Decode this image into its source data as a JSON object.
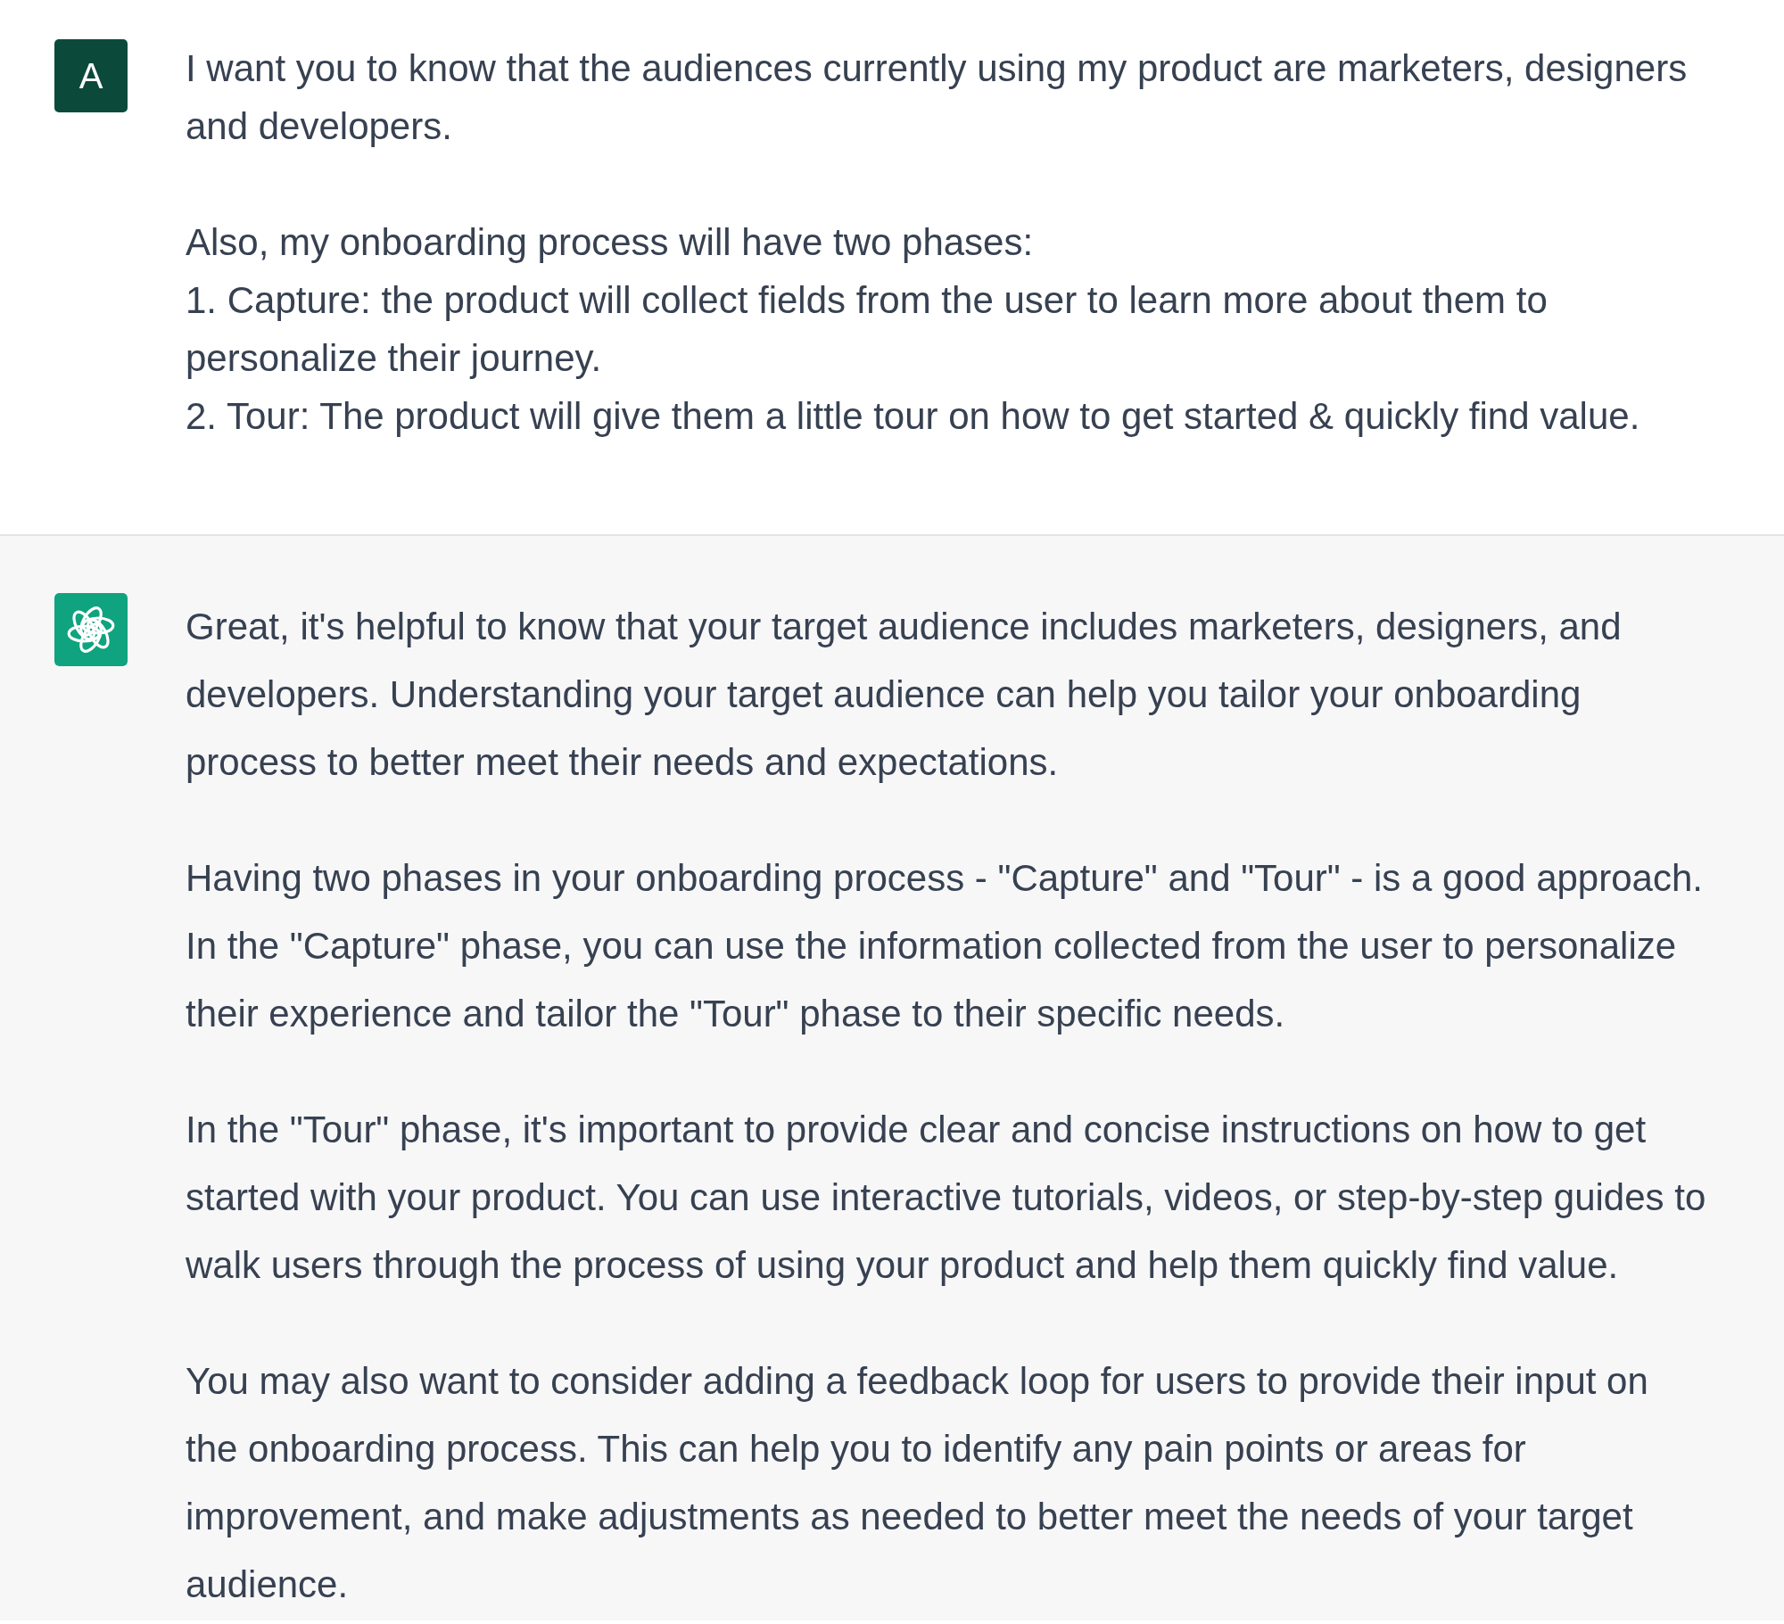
{
  "messages": [
    {
      "kind": "user",
      "avatar": {
        "initial": "A"
      },
      "paragraphs": [
        [
          "I want you to know that the audiences currently using my product are marketers, designers\nand developers."
        ],
        [
          "Also, my onboarding process will have two phases:",
          "1. Capture: the product will collect fields from the user to learn more about them to\npersonalize their journey.",
          "2. Tour: The product will give them a little tour on how to get started & quickly find value."
        ]
      ]
    },
    {
      "kind": "assistant",
      "paragraphs": [
        [
          "Great, it's helpful to know that your target audience includes marketers, designers, and\ndevelopers. Understanding your target audience can help you tailor your onboarding\nprocess to better meet their needs and expectations."
        ],
        [
          "Having two phases in your onboarding process - \"Capture\" and \"Tour\" - is a good approach.\nIn the \"Capture\" phase, you can use the information collected from the user to personalize\ntheir experience and tailor the \"Tour\" phase to their specific needs."
        ],
        [
          "In the \"Tour\" phase, it's important to provide clear and concise instructions on how to get\nstarted with your product. You can use interactive tutorials, videos, or step-by-step guides to\nwalk users through the process of using your product and help them quickly find value."
        ],
        [
          "You may also want to consider adding a feedback loop for users to provide their input on\nthe onboarding process. This can help you to identify any pain points or areas for\nimprovement, and make adjustments as needed to better meet the needs of your target\naudience."
        ]
      ]
    }
  ]
}
